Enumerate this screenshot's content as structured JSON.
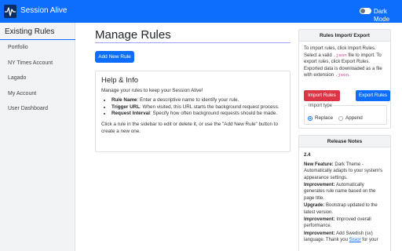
{
  "app": {
    "name": "Session Alive",
    "logo_icon": "heartbeat-icon",
    "dark_mode_label": "Dark Mode",
    "dark_mode_on": false,
    "accent_color": "#0d6efd"
  },
  "sidebar": {
    "title": "Existing Rules",
    "items": [
      {
        "label": "Portfolio"
      },
      {
        "label": "NY Times Account"
      },
      {
        "label": "Lagado"
      },
      {
        "label": "My Account"
      },
      {
        "label": "User Dashboard"
      }
    ]
  },
  "main": {
    "title": "Manage Rules",
    "add_button": "Add New Rule",
    "help": {
      "title": "Help & Info",
      "intro": "Manage your rules to keep your Session Alive!",
      "items": [
        {
          "term": "Rule Name",
          "desc": ": Enter a descriptive name to identify your rule."
        },
        {
          "term": "Trigger URL",
          "desc": ": When visited, this URL starts the background request process."
        },
        {
          "term": "Request Interval",
          "desc": ": Specify how often background requests should be made."
        }
      ],
      "outro": "Click a rule in the sidebar to edit or delete it, or use the \"Add New Rule\" button to create a new one."
    }
  },
  "import_export": {
    "title": "Rules Import/ Export",
    "desc_1": "To import rules, click Import Rules. Select a valid ",
    "code_1": ".json",
    "desc_2": " file to import.",
    "desc_3": "To export rules, click Export Rules. Exported data is downloaded as a file with extension ",
    "code_2": ".json",
    "desc_4": ".",
    "import_button": "Import Rules",
    "export_button": "Export Rules",
    "import_type_label": "Import type",
    "options": [
      {
        "label": "Replace",
        "checked": true
      },
      {
        "label": "Append",
        "checked": false
      }
    ]
  },
  "release_notes": {
    "title": "Release Notes",
    "version": "2.4",
    "items": [
      {
        "term": "New Feature:",
        "desc": " Dark Theme - Automatically adapts to your system's appearance settings."
      },
      {
        "term": "Improvement:",
        "desc": " Automatically generates rule name based on the page title."
      },
      {
        "term": "Upgrade:",
        "desc": " Bootstrap updated to the latest version."
      },
      {
        "term": "Improvement:",
        "desc": " Improved overall performance."
      },
      {
        "term": "Improvement:",
        "desc": " Add Swedish (sv) language. Thank you "
      }
    ],
    "link_text": "Sisior",
    "link_suffix": " for your"
  }
}
